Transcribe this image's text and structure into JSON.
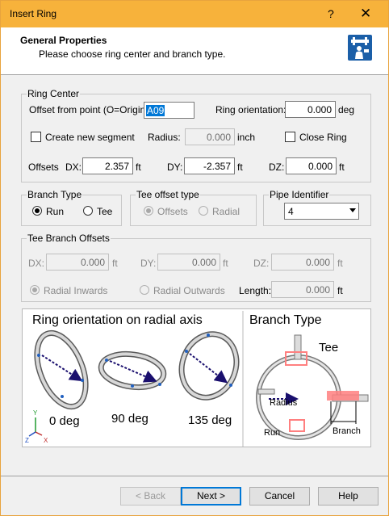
{
  "window": {
    "title": "Insert Ring",
    "help_glyph": "?",
    "close_glyph": "✕"
  },
  "header": {
    "title": "General Properties",
    "subtitle": "Please choose ring center and branch type.",
    "icon": "pipe-ring-icon"
  },
  "ring_center": {
    "legend": "Ring Center",
    "offset_label": "Offset from point (O=Origin):",
    "offset_value": "A09",
    "orientation_label": "Ring orientation:",
    "orientation_value": "0.000",
    "orientation_unit": "deg",
    "create_segment_label": "Create new segment",
    "create_segment_checked": false,
    "radius_label": "Radius:",
    "radius_value": "0.000",
    "radius_unit": "inch",
    "close_ring_label": "Close Ring",
    "close_ring_checked": false,
    "offsets_label": "Offsets",
    "dx_label": "DX:",
    "dx_value": "2.357",
    "dx_unit": "ft",
    "dy_label": "DY:",
    "dy_value": "-2.357",
    "dy_unit": "ft",
    "dz_label": "DZ:",
    "dz_value": "0.000",
    "dz_unit": "ft"
  },
  "branch_type": {
    "legend": "Branch Type",
    "run_label": "Run",
    "tee_label": "Tee",
    "selected": "Run"
  },
  "tee_offset_type": {
    "legend": "Tee offset type",
    "offsets_label": "Offsets",
    "radial_label": "Radial",
    "selected": "Offsets"
  },
  "pipe_identifier": {
    "legend": "Pipe Identifier",
    "value": "4"
  },
  "tee_branch_offsets": {
    "legend": "Tee Branch Offsets",
    "dx_label": "DX:",
    "dx_value": "0.000",
    "dx_unit": "ft",
    "dy_label": "DY:",
    "dy_value": "0.000",
    "dy_unit": "ft",
    "dz_label": "DZ:",
    "dz_value": "0.000",
    "dz_unit": "ft",
    "radial_inwards_label": "Radial Inwards",
    "radial_outwards_label": "Radial Outwards",
    "selected": "Radial Inwards",
    "length_label": "Length:",
    "length_value": "0.000",
    "length_unit": "ft"
  },
  "diagram": {
    "left_title": "Ring orientation on radial axis",
    "deg0": "0 deg",
    "deg90": "90 deg",
    "deg135": "135 deg",
    "axis_y": "Y",
    "axis_z": "Z",
    "axis_x": "X",
    "right_title": "Branch Type",
    "tee_label": "Tee",
    "radius_label": "Radius",
    "run_label": "Run",
    "branch_label": "Branch",
    "highlight_color": "#ff7f7f",
    "arrow_color": "#1a0f6e"
  },
  "buttons": {
    "back": "< Back",
    "next": "Next >",
    "cancel": "Cancel",
    "help": "Help"
  }
}
